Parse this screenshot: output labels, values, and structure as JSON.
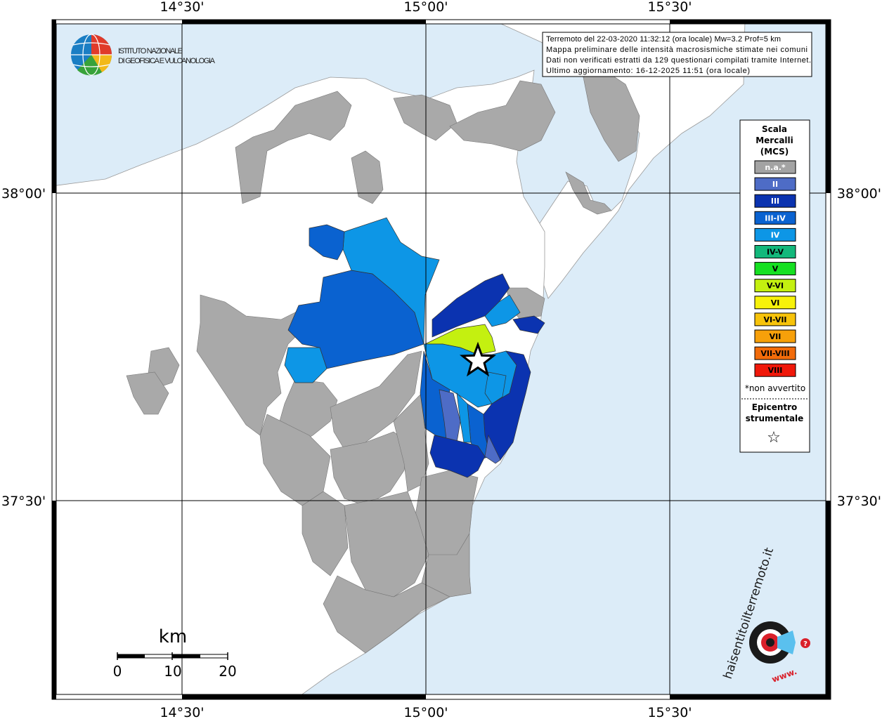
{
  "map": {
    "colors": {
      "sea": "#dcecf8",
      "land": "#ffffff",
      "na": "#a9a9a9",
      "intensity_II": "#4e6cc6",
      "intensity_III": "#0b33b0",
      "intensity_III_IV": "#0a62d0",
      "intensity_IV": "#0d96e6",
      "intensity_V_VI": "#c4f010"
    },
    "lon_labels": [
      "14°30'",
      "15°00'",
      "15°30'"
    ],
    "lat_labels": [
      "38°00'",
      "37°30'"
    ]
  },
  "info_box": {
    "line1": "Terremoto del 22-03-2020 11:32:12 (ora locale) Mw=3.2 Prof=5 km",
    "line2": "Mappa preliminare delle intensità macrosismiche stimate nei comuni",
    "line3": "Dati non verificati estratti da 129 questionari compilati tramite Internet.",
    "line4": "Ultimo aggiornamento: 16-12-2025 11:51 (ora locale)"
  },
  "logo_ingv": {
    "line1": "ISTITUTO NAZIONALE",
    "line2": "DI GEOFISICA E VULCANOLOGIA"
  },
  "legend": {
    "title1": "Scala",
    "title2": "Mercalli",
    "title3": "(MCS)",
    "items": [
      {
        "label": "n.a.*",
        "color": "#a3a3a3"
      },
      {
        "label": "II",
        "color": "#4e6cc6"
      },
      {
        "label": "III",
        "color": "#0b33b0"
      },
      {
        "label": "III-IV",
        "color": "#0a62d0"
      },
      {
        "label": "IV",
        "color": "#0d96e6"
      },
      {
        "label": "IV-V",
        "color": "#13b87b"
      },
      {
        "label": "V",
        "color": "#16e022"
      },
      {
        "label": "V-VI",
        "color": "#c4f010"
      },
      {
        "label": "VI",
        "color": "#f7f20a"
      },
      {
        "label": "VI-VII",
        "color": "#f7c30a"
      },
      {
        "label": "VII",
        "color": "#f7a00a"
      },
      {
        "label": "VII-VIII",
        "color": "#f26b0a"
      },
      {
        "label": "VIII",
        "color": "#f0180a"
      }
    ],
    "footnote": "*non avvertito",
    "epi1": "Epicentro",
    "epi2": "strumentale",
    "epi_symbol": "☆"
  },
  "scale_bar": {
    "unit": "km",
    "ticks": [
      "0",
      "10",
      "20"
    ]
  },
  "logo_hsit": {
    "text": "haisentitoilterremoto.it",
    "www": "www."
  }
}
